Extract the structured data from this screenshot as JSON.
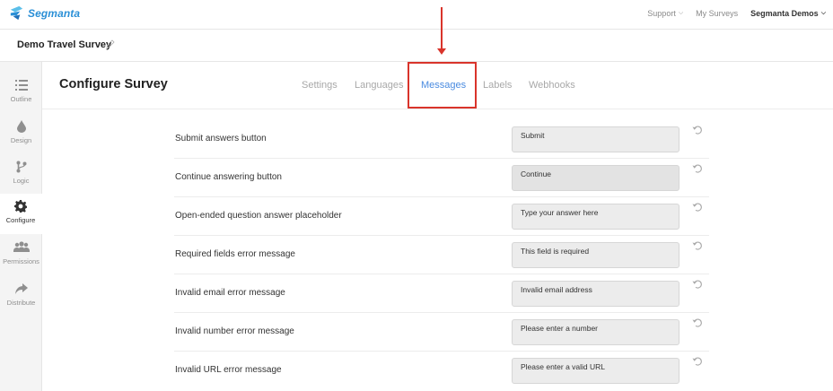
{
  "app": {
    "brand": "Segmanta",
    "brand_color": "#2a8fd6"
  },
  "topnav": {
    "support": "Support",
    "my_surveys": "My Surveys",
    "account": "Segmanta Demos"
  },
  "survey": {
    "title": "Demo Travel Survey"
  },
  "sidebar": {
    "items": [
      {
        "label": "Outline",
        "icon": "list-icon"
      },
      {
        "label": "Design",
        "icon": "drop-icon"
      },
      {
        "label": "Logic",
        "icon": "branch-icon"
      },
      {
        "label": "Configure",
        "icon": "gear-icon",
        "active": true
      },
      {
        "label": "Permissions",
        "icon": "users-icon"
      },
      {
        "label": "Distribute",
        "icon": "share-icon"
      }
    ]
  },
  "page": {
    "title": "Configure Survey",
    "tabs": [
      {
        "label": "Settings"
      },
      {
        "label": "Languages"
      },
      {
        "label": "Messages",
        "active": true
      },
      {
        "label": "Labels"
      },
      {
        "label": "Webhooks"
      }
    ],
    "accent_color": "#4a8be0",
    "highlight_color": "#d9342b"
  },
  "messages": [
    {
      "label": "Submit answers button",
      "value": "Submit"
    },
    {
      "label": "Continue answering button",
      "value": "Continue"
    },
    {
      "label": "Open-ended question answer placeholder",
      "value": "Type your answer here"
    },
    {
      "label": "Required fields error message",
      "value": "This field is required"
    },
    {
      "label": "Invalid email error message",
      "value": "Invalid email address"
    },
    {
      "label": "Invalid number error message",
      "value": "Please enter a number"
    },
    {
      "label": "Invalid URL error message",
      "value": "Please enter a valid URL"
    }
  ]
}
